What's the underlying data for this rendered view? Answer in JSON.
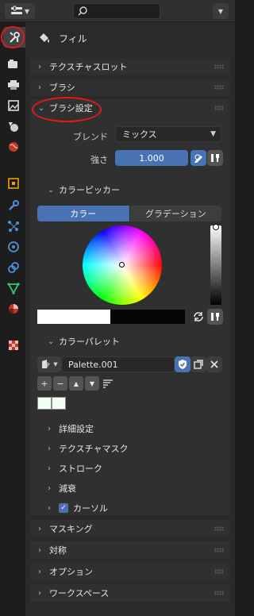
{
  "context": {
    "label": "フィル"
  },
  "panels": {
    "texture_slot": "テクスチャスロット",
    "brush": "ブラシ",
    "brush_settings": "ブラシ設定",
    "masking": "マスキング",
    "symmetry": "対称",
    "options": "オプション",
    "workspace": "ワークスペース"
  },
  "brush_settings": {
    "blend_label": "ブレンド",
    "blend_value": "ミックス",
    "strength_label": "強さ",
    "strength_value": "1.000",
    "color_picker_title": "カラーピッカー",
    "mode_color": "カラー",
    "mode_gradient": "グラデーション",
    "color_palette_title": "カラーパレット",
    "palette_name": "Palette.001",
    "palette_buttons": {
      "add": "+",
      "remove": "−",
      "up": "▲",
      "down": "▼"
    }
  },
  "subpanels": {
    "advanced": "詳細設定",
    "texture_mask": "テクスチャマスク",
    "stroke": "ストローク",
    "falloff": "減衰",
    "cursor": "カーソル"
  },
  "colors": {
    "accent": "#4772b3",
    "highlight_ring": "#e01b1b",
    "primary_color": "#ffffff",
    "secondary_color": "#050505",
    "palette_color": "#f1fff4"
  },
  "icons": {
    "editor_type": "properties-editor-icon",
    "search": "search-icon",
    "active_tab": "tool-settings-icon"
  }
}
